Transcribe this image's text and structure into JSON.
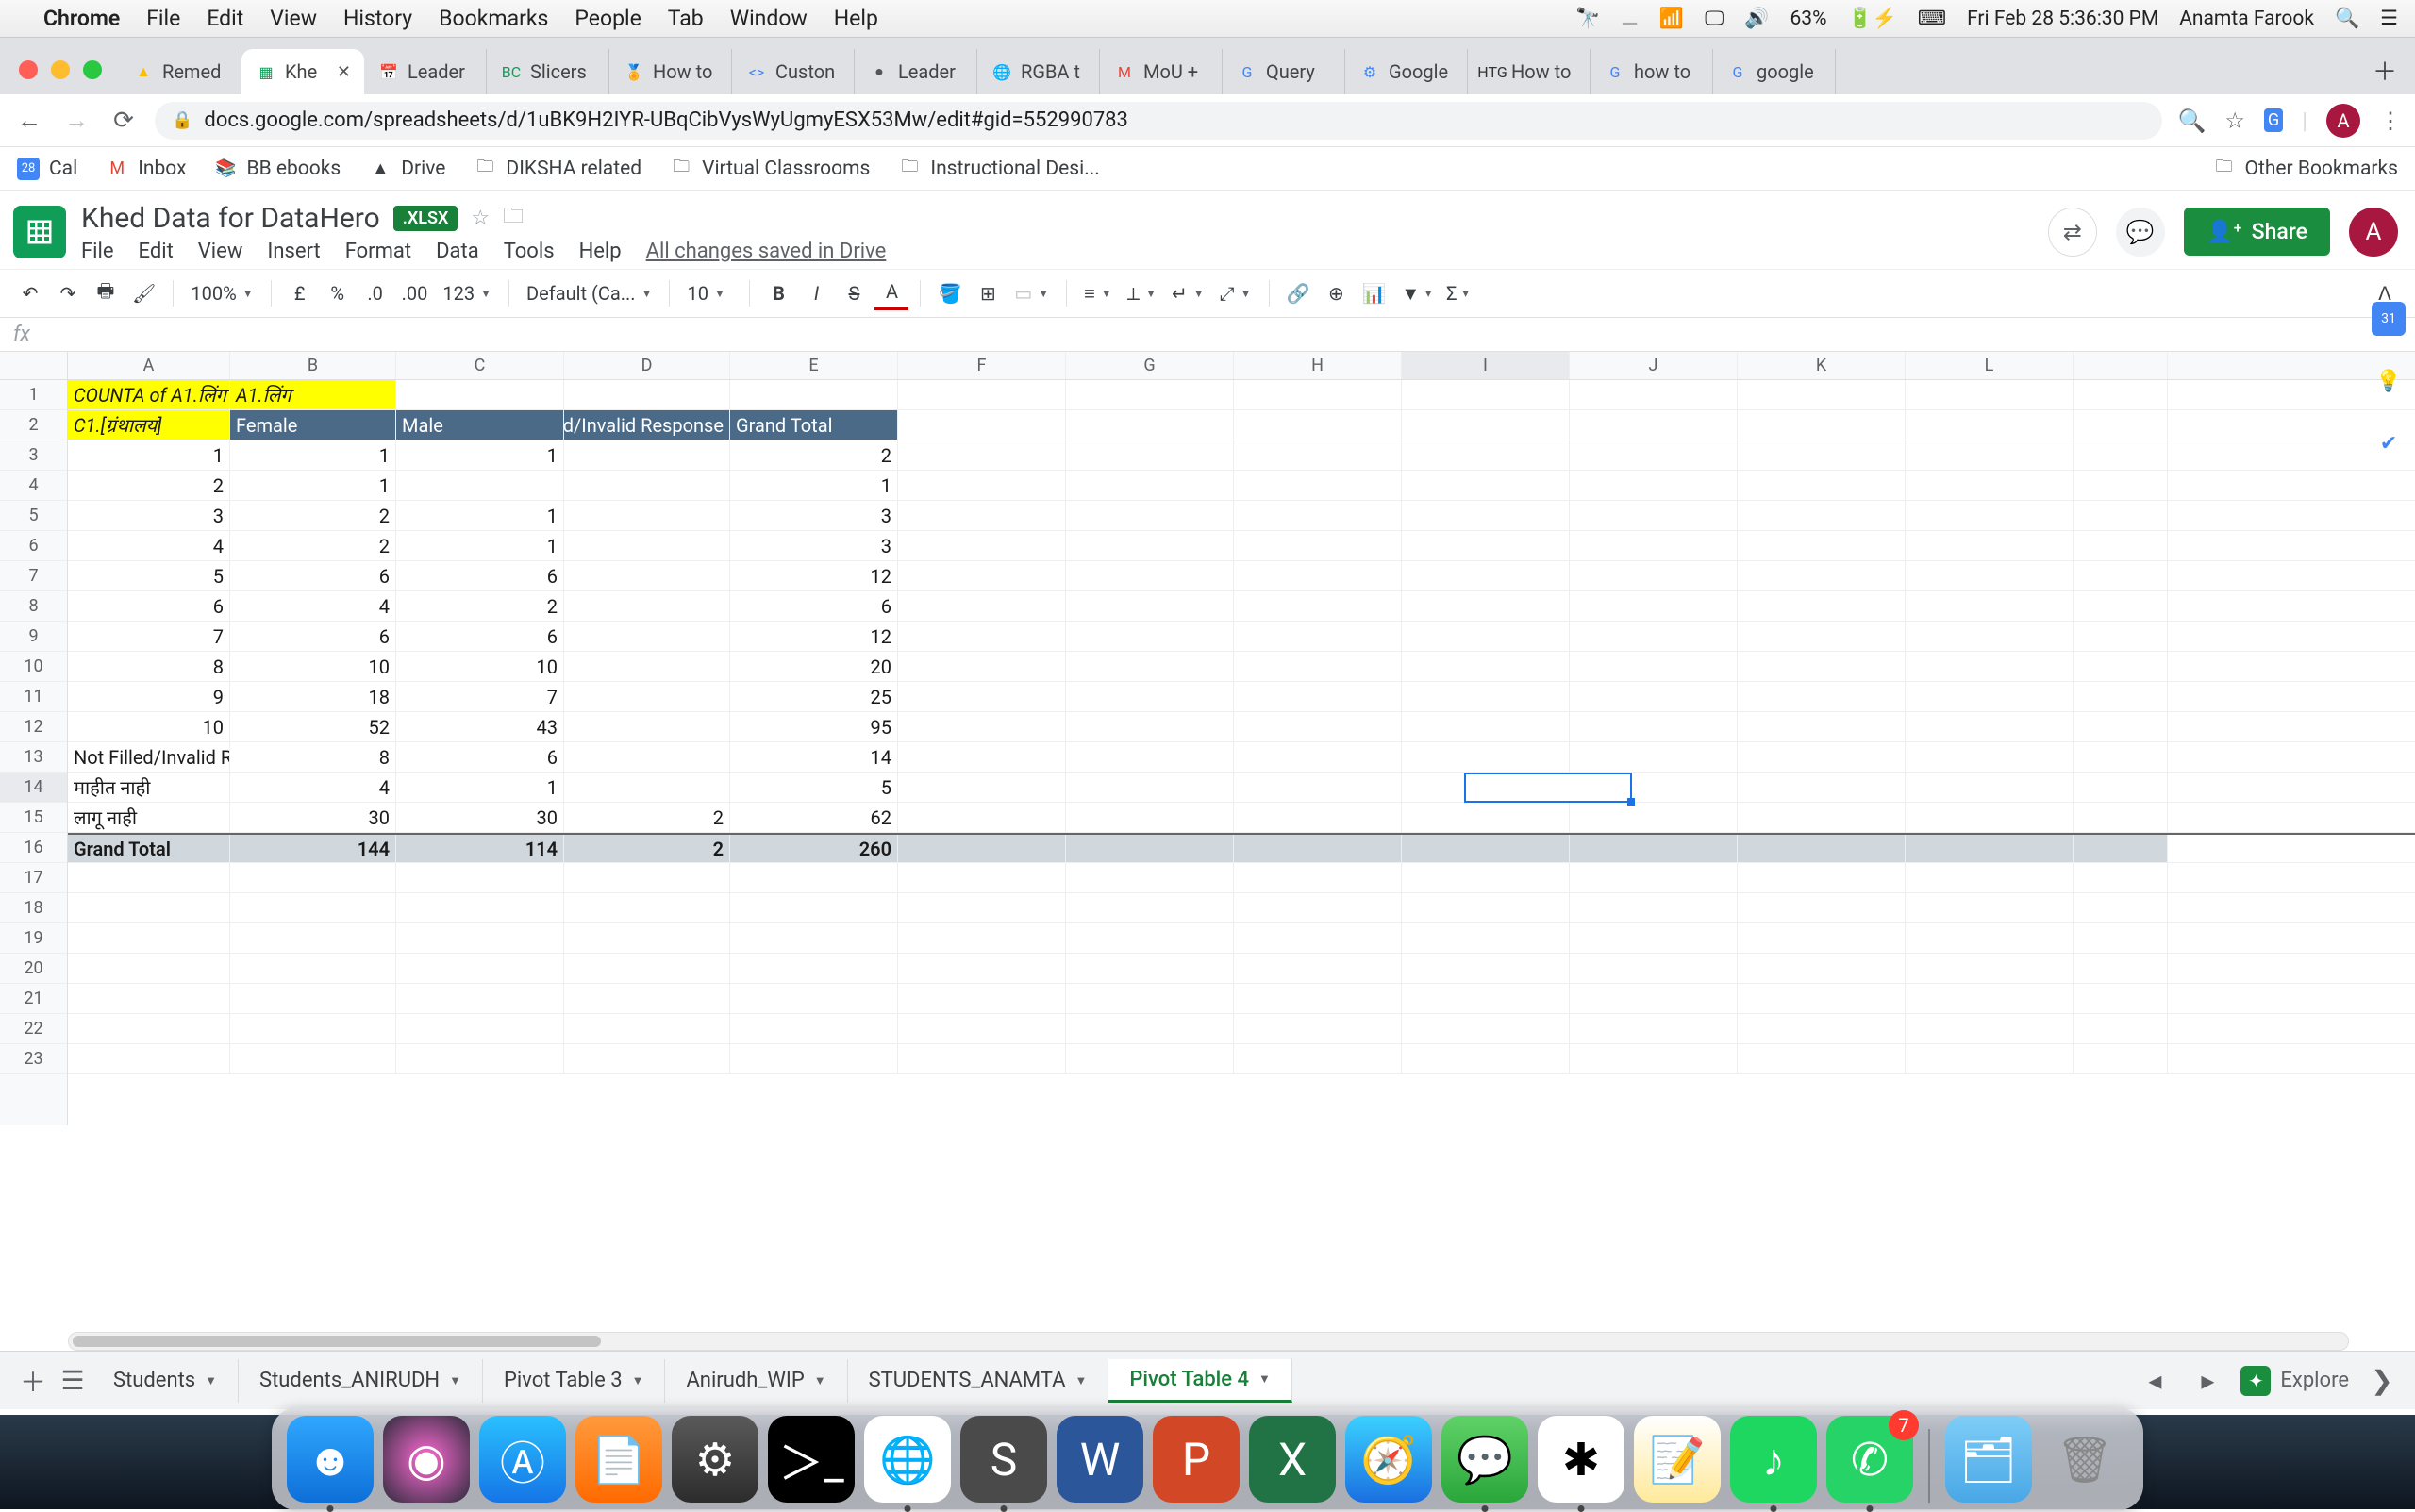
{
  "menubar": {
    "app": "Chrome",
    "items": [
      "File",
      "Edit",
      "View",
      "History",
      "Bookmarks",
      "People",
      "Tab",
      "Window",
      "Help"
    ],
    "battery": "63%",
    "datetime": "Fri Feb 28  5:36:30 PM",
    "user": "Anamta Farook"
  },
  "tabs": [
    {
      "label": "Remed"
    },
    {
      "label": "Khe",
      "active": true
    },
    {
      "label": "Leader"
    },
    {
      "label": "Slicers"
    },
    {
      "label": "How to"
    },
    {
      "label": "Custon"
    },
    {
      "label": "Leader"
    },
    {
      "label": "RGBA t"
    },
    {
      "label": "MoU +"
    },
    {
      "label": "Query"
    },
    {
      "label": "Google"
    },
    {
      "label": "How to"
    },
    {
      "label": "how to"
    },
    {
      "label": "google"
    }
  ],
  "url": "docs.google.com/spreadsheets/d/1uBK9H2IYR-UBqCibVysWyUgmyESX53Mw/edit#gid=552990783",
  "bookmarks": [
    "Cal",
    "Inbox",
    "BB ebooks",
    "Drive",
    "DIKSHA related",
    "Virtual Classrooms",
    "Instructional Desi..."
  ],
  "otherBookmarks": "Other Bookmarks",
  "doc": {
    "title": "Khed Data for DataHero",
    "badge": ".XLSX",
    "menu": [
      "File",
      "Edit",
      "View",
      "Insert",
      "Format",
      "Data",
      "Tools",
      "Help"
    ],
    "saved": "All changes saved in Drive",
    "share": "Share",
    "avatar": "A"
  },
  "toolbar": {
    "zoom": "100%",
    "font": "Default (Ca...",
    "size": "10"
  },
  "fx": "fx",
  "columns": [
    "A",
    "B",
    "C",
    "D",
    "E",
    "F",
    "G",
    "H",
    "I",
    "J",
    "K",
    "L"
  ],
  "grid": {
    "r1": {
      "A": "COUNTA of A1.लिंग",
      "B": "A1.लिंग"
    },
    "r2": {
      "A": "C1.[ग्रंथालय]",
      "B": "Female",
      "C": "Male",
      "D": "Not Filled/Invalid Response",
      "E": "Grand Total"
    },
    "rows": [
      {
        "A": "1",
        "B": "1",
        "C": "1",
        "D": "",
        "E": "2"
      },
      {
        "A": "2",
        "B": "1",
        "C": "",
        "D": "",
        "E": "1"
      },
      {
        "A": "3",
        "B": "2",
        "C": "1",
        "D": "",
        "E": "3"
      },
      {
        "A": "4",
        "B": "2",
        "C": "1",
        "D": "",
        "E": "3"
      },
      {
        "A": "5",
        "B": "6",
        "C": "6",
        "D": "",
        "E": "12"
      },
      {
        "A": "6",
        "B": "4",
        "C": "2",
        "D": "",
        "E": "6"
      },
      {
        "A": "7",
        "B": "6",
        "C": "6",
        "D": "",
        "E": "12"
      },
      {
        "A": "8",
        "B": "10",
        "C": "10",
        "D": "",
        "E": "20"
      },
      {
        "A": "9",
        "B": "18",
        "C": "7",
        "D": "",
        "E": "25"
      },
      {
        "A": "10",
        "B": "52",
        "C": "43",
        "D": "",
        "E": "95"
      },
      {
        "A": "Not Filled/Invalid R",
        "B": "8",
        "C": "6",
        "D": "",
        "E": "14",
        "left": true
      },
      {
        "A": "माहीत नाही",
        "B": "4",
        "C": "1",
        "D": "",
        "E": "5",
        "left": true
      },
      {
        "A": "लागू नाही",
        "B": "30",
        "C": "30",
        "D": "2",
        "E": "62",
        "left": true
      }
    ],
    "total": {
      "A": "Grand Total",
      "B": "144",
      "C": "114",
      "D": "2",
      "E": "260"
    }
  },
  "sheetTabs": [
    "Students",
    "Students_ANIRUDH",
    "Pivot Table 3",
    "Anirudh_WIP",
    "STUDENTS_ANAMTA",
    "Pivot Table 4"
  ],
  "activeSheet": 5,
  "explore": "Explore",
  "whatsappBadge": "7"
}
